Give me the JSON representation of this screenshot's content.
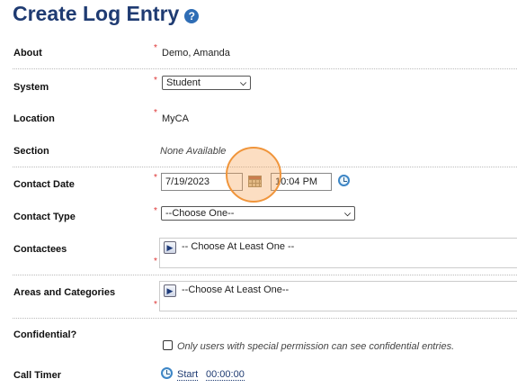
{
  "page": {
    "title": "Create Log Entry"
  },
  "fields": {
    "about": {
      "label": "About",
      "value": "Demo, Amanda"
    },
    "system": {
      "label": "System",
      "selected": "Student"
    },
    "location": {
      "label": "Location",
      "value": "MyCA"
    },
    "section": {
      "label": "Section",
      "value": "None Available"
    },
    "contact_date": {
      "label": "Contact Date",
      "date": "7/19/2023",
      "time": "10:04 PM"
    },
    "contact_type": {
      "label": "Contact Type",
      "selected": "--Choose One--"
    },
    "contactees": {
      "label": "Contactees",
      "placeholder": "-- Choose At Least One --"
    },
    "areas": {
      "label": "Areas and Categories",
      "placeholder": "--Choose At Least One--"
    },
    "confidential": {
      "label": "Confidential?",
      "checkbox_text": "Only users with special permission can see confidential entries.",
      "checked": false
    },
    "call_timer": {
      "label": "Call Timer",
      "start": "Start",
      "elapsed": "00:00:00"
    }
  },
  "required_marker": "*",
  "icons": {
    "help": "help-icon",
    "calendar": "calendar-icon",
    "clock": "clock-icon",
    "arrow": "arrow-right-icon",
    "chevron": "chevron-down-icon"
  },
  "colors": {
    "title": "#1f3b72",
    "required": "#d33333",
    "highlight": "#f0953b"
  }
}
